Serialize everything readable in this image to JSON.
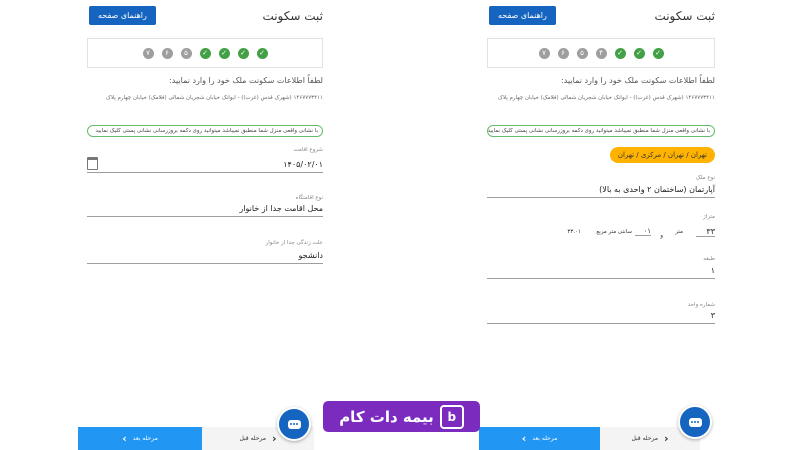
{
  "left": {
    "title": "ثبت سکونت",
    "guide_label": "راهنمای صفحه",
    "steps": [
      {
        "type": "done",
        "label": "✓"
      },
      {
        "type": "done",
        "label": "✓"
      },
      {
        "type": "done",
        "label": "✓"
      },
      {
        "type": "done",
        "label": "✓"
      },
      {
        "type": "pending",
        "label": "۵"
      },
      {
        "type": "pending",
        "label": "۶"
      },
      {
        "type": "pending",
        "label": "۷"
      }
    ],
    "intro": "لطفاً اطلاعات سکونت ملک خود را وارد نمایید:",
    "address": "۱۴۶۷۷۷۳۴۱۱ (شهرک قدس (غرب)) - ایوانک خیابان شجریان شمالی (فلامک) خیابان چهارم پلاک",
    "hint": "با نشانی واقعی منزل شما منطبق نمیباشد میتوانید روی دکمه بروزرسانی نشانی پستی کلیک نمایید",
    "fields": [
      {
        "label": "شروع اقامت",
        "value": "۱۴۰۵/۰۲/۰۱"
      },
      {
        "label": "نوع اقامتگاه",
        "value": "محل اقامت جدا از خانوار"
      },
      {
        "label": "علت زندگی جدا از خانوار",
        "value": "دانشجو"
      }
    ],
    "next_label": "مرحله بعد",
    "prev_label": "مرحله قبل"
  },
  "right": {
    "title": "ثبت سکونت",
    "guide_label": "راهنمای صفحه",
    "steps": [
      {
        "type": "done",
        "label": "✓"
      },
      {
        "type": "done",
        "label": "✓"
      },
      {
        "type": "done",
        "label": "✓"
      },
      {
        "type": "pending",
        "label": "۴"
      },
      {
        "type": "pending",
        "label": "۵"
      },
      {
        "type": "pending",
        "label": "۶"
      },
      {
        "type": "pending",
        "label": "۷"
      }
    ],
    "intro": "لطفاً اطلاعات سکونت ملک خود را وارد نمایید:",
    "address": "۱۴۶۷۷۷۳۴۱۱ (شهرک قدس (غرب)) - ایوانک خیابان شجریان شمالی (فلامک) خیابان چهارم پلاک",
    "hint": "با نشانی واقعی منزل شما منطبق نمیباشد میتوانید روی دکمه بروزرسانی نشانی پستی کلیک نمایید",
    "location_chip": "تهران / تهران / مرکزی / تهران",
    "fields": [
      {
        "label": "نوع ملک",
        "value": "آپارتمان (ساختمان ۲ واحدی به بالا)"
      },
      {
        "label": "متراژ",
        "value": "۳۳"
      },
      {
        "label": "طبقه",
        "value": "۱"
      },
      {
        "label": "شماره واحد",
        "value": "۳"
      }
    ],
    "area_unit": "متر",
    "area_and": "و",
    "area_cm_value": "۰۱",
    "area_cm_label": "سانتی متر مربع",
    "area_total": "۳۳.۰۱",
    "next_label": "مرحله بعد",
    "prev_label": "مرحله قبل"
  },
  "watermark": {
    "text": "بیمه دات کام",
    "logo_letter": "b"
  }
}
